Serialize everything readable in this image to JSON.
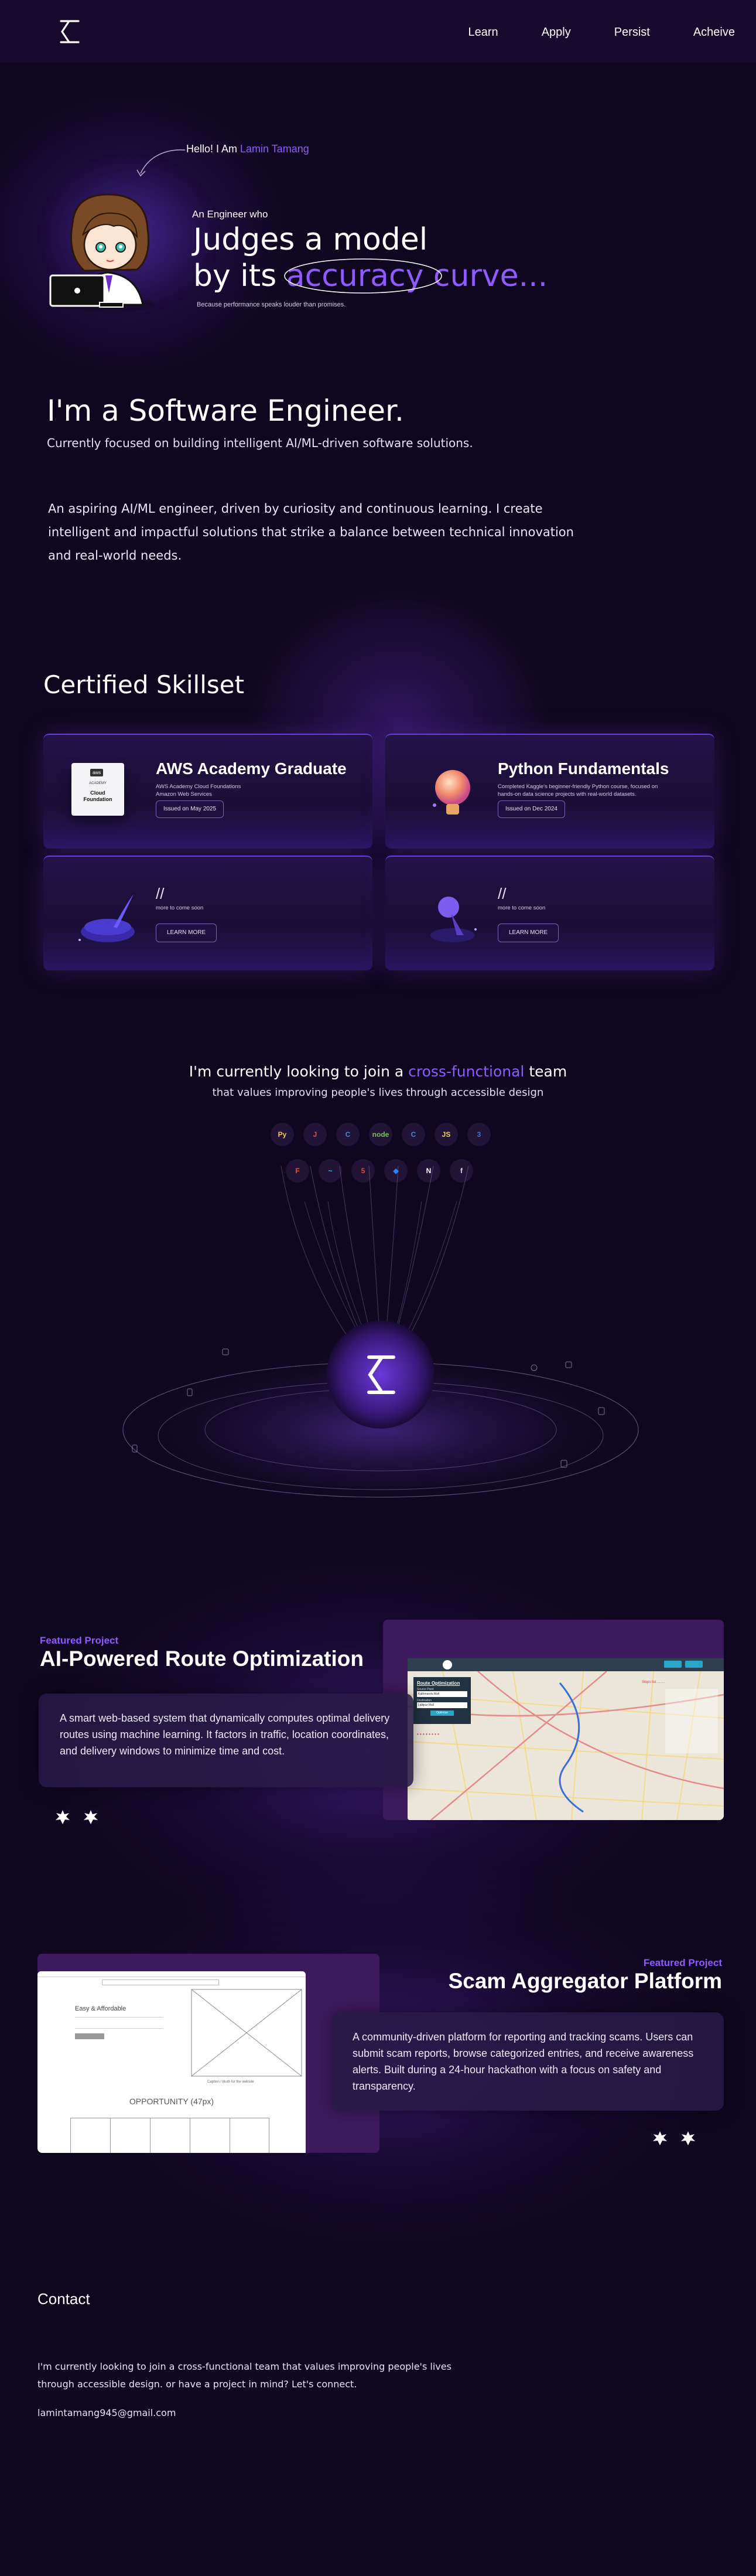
{
  "nav": {
    "links": [
      "Learn",
      "Apply",
      "Persist",
      "Acheive"
    ]
  },
  "hero": {
    "hello_prefix": "Hello! I Am ",
    "hello_name": "Lamin Tamang",
    "intro": "An Engineer who",
    "line1": "Judges a model",
    "line2_prefix": "by its ",
    "line2_accent": "accuracy curve",
    "line2_suffix": "...",
    "tagline": "Because performance speaks louder than promises."
  },
  "about": {
    "title": "I'm a Software Engineer.",
    "subtitle": "Currently focused on building intelligent AI/ML-driven software solutions.",
    "description": "An aspiring AI/ML engineer, driven by curiosity and continuous learning. I create intelligent and impactful solutions that strike a balance between technical innovation and real-world needs."
  },
  "certs": {
    "title": "Certified Skillset",
    "cards": [
      {
        "title": "AWS Academy Graduate",
        "desc": "AWS Academy Cloud Foundations Amazon Web Services",
        "button": "Issued on May 2025",
        "badge_lines": [
          "aws",
          "ACADEMY",
          "Cloud",
          "Foundation"
        ]
      },
      {
        "title": "Python Fundamentals",
        "desc": "Completed Kaggle's beginner-friendly Python course, focused on hands-on data science projects with real-world datasets.",
        "button": "Issued on Dec 2024"
      },
      {
        "slash": "//",
        "soon": "more to come soon",
        "button": "LEARN MORE"
      },
      {
        "slash": "//",
        "soon": "more to come soon",
        "button": "LEARN MORE"
      }
    ]
  },
  "team": {
    "prefix": "I'm currently looking to join a ",
    "accent": "cross-functional",
    "suffix": " team",
    "sub": "that values improving people's lives through accessible design"
  },
  "tech_icons": {
    "row1": [
      {
        "name": "python-icon",
        "glyph": "Py",
        "color": "#f2c94c"
      },
      {
        "name": "java-icon",
        "glyph": "J",
        "color": "#e0573a"
      },
      {
        "name": "c-icon",
        "glyph": "C",
        "color": "#3b8fd9"
      },
      {
        "name": "node-icon",
        "glyph": "node",
        "color": "#7cc35a"
      },
      {
        "name": "cpp-icon",
        "glyph": "C",
        "color": "#3b8fd9"
      },
      {
        "name": "javascript-icon",
        "glyph": "JS",
        "color": "#f0d64a"
      },
      {
        "name": "css-icon",
        "glyph": "3",
        "color": "#3a7bd5"
      }
    ],
    "row2": [
      {
        "name": "figma-icon",
        "glyph": "F",
        "color": "#f24e1e"
      },
      {
        "name": "tailwind-icon",
        "glyph": "~",
        "color": "#38bdf8"
      },
      {
        "name": "html-icon",
        "glyph": "5",
        "color": "#e44d26"
      },
      {
        "name": "jira-icon",
        "glyph": "◆",
        "color": "#2684ff"
      },
      {
        "name": "notion-icon",
        "glyph": "N",
        "color": "#ffffff"
      },
      {
        "name": "framer-icon",
        "glyph": "f",
        "color": "#d8d8d8"
      }
    ]
  },
  "projects": [
    {
      "label": "Featured  Project",
      "title": "AI-Powered Route Optimization",
      "desc": "A smart web-based system that dynamically computes optimal delivery routes using machine learning. It factors in traffic, location coordinates, and delivery windows to minimize time and cost.",
      "screen": {
        "panel_title": "Route Optimization",
        "field1_label": "Source Point",
        "field1_value": "Kathmandu Mall",
        "field2_label": "Destination",
        "field2_value": "Lalitpur Mall",
        "button": "Optimize"
      }
    },
    {
      "label": "Featured  Project",
      "title": "Scam Aggregator Platform",
      "desc": "A community-driven platform for reporting and tracking scams. Users can submit scam reports, browse categorized entries, and receive awareness alerts. Built during a 24-hour hackathon with a focus on safety and transparency.",
      "screen": {
        "hero_title": "Easy & Affordable",
        "section_title": "OPPORTUNITY (47px)",
        "caption": "Caption / blurb for the website"
      }
    }
  ],
  "contact": {
    "title": "Contact",
    "text": "I'm currently looking to join a cross-functional team that values improving people's lives through accessible design. or have a project in mind? Let's connect.",
    "email": "lamintamang945@gmail.com"
  },
  "colors": {
    "accent": "#8f5bff",
    "background": "#0f0720",
    "nav": "#170a2e"
  }
}
